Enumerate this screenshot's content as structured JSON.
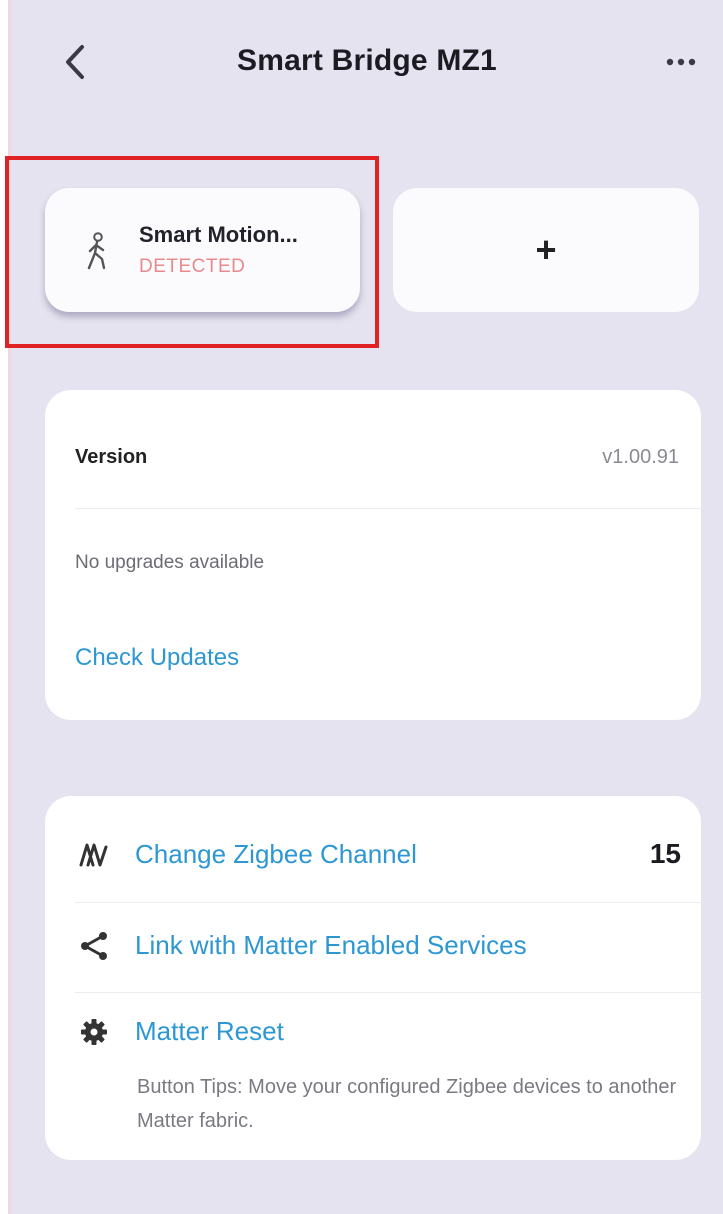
{
  "header": {
    "title": "Smart Bridge MZ1"
  },
  "devices": {
    "motion_name": "Smart Motion...",
    "motion_status": "DETECTED",
    "add_label": "+"
  },
  "version": {
    "label": "Version",
    "value": "v1.00.91",
    "upgrade_status": "No upgrades available",
    "check_updates": "Check Updates"
  },
  "settings": {
    "zigbee_channel_label": "Change Zigbee Channel",
    "zigbee_channel_value": "15",
    "matter_link_label": "Link with Matter Enabled Services",
    "matter_reset_label": "Matter Reset",
    "matter_reset_tip": "Button Tips: Move your configured Zigbee devices to another Matter fabric."
  },
  "colors": {
    "background": "#e6e3f0",
    "accent_link": "#2d97d4",
    "status_detected": "#e88a8c",
    "highlight": "#e02126"
  },
  "icons": {
    "back": "chevron-left-icon",
    "more": "ellipsis-icon",
    "motion": "walking-person-icon",
    "zigbee": "zigbee-channel-icon",
    "share": "share-icon",
    "reset": "gear-icon"
  }
}
